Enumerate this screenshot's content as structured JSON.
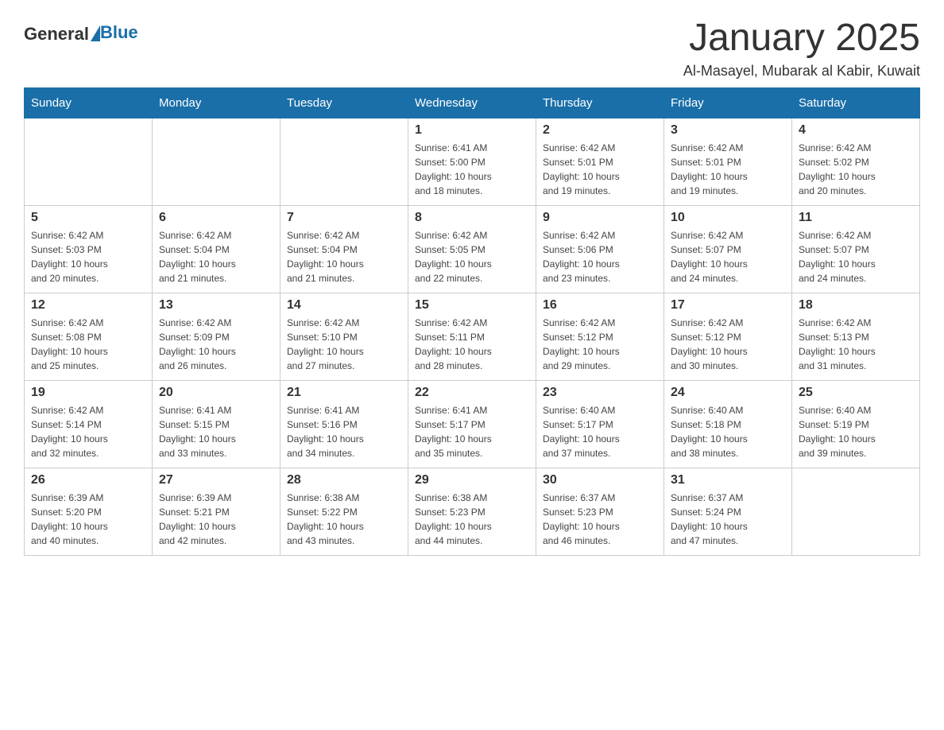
{
  "logo": {
    "general": "General",
    "blue": "Blue"
  },
  "title": "January 2025",
  "subtitle": "Al-Masayel, Mubarak al Kabir, Kuwait",
  "headers": [
    "Sunday",
    "Monday",
    "Tuesday",
    "Wednesday",
    "Thursday",
    "Friday",
    "Saturday"
  ],
  "weeks": [
    [
      {
        "day": "",
        "info": ""
      },
      {
        "day": "",
        "info": ""
      },
      {
        "day": "",
        "info": ""
      },
      {
        "day": "1",
        "info": "Sunrise: 6:41 AM\nSunset: 5:00 PM\nDaylight: 10 hours\nand 18 minutes."
      },
      {
        "day": "2",
        "info": "Sunrise: 6:42 AM\nSunset: 5:01 PM\nDaylight: 10 hours\nand 19 minutes."
      },
      {
        "day": "3",
        "info": "Sunrise: 6:42 AM\nSunset: 5:01 PM\nDaylight: 10 hours\nand 19 minutes."
      },
      {
        "day": "4",
        "info": "Sunrise: 6:42 AM\nSunset: 5:02 PM\nDaylight: 10 hours\nand 20 minutes."
      }
    ],
    [
      {
        "day": "5",
        "info": "Sunrise: 6:42 AM\nSunset: 5:03 PM\nDaylight: 10 hours\nand 20 minutes."
      },
      {
        "day": "6",
        "info": "Sunrise: 6:42 AM\nSunset: 5:04 PM\nDaylight: 10 hours\nand 21 minutes."
      },
      {
        "day": "7",
        "info": "Sunrise: 6:42 AM\nSunset: 5:04 PM\nDaylight: 10 hours\nand 21 minutes."
      },
      {
        "day": "8",
        "info": "Sunrise: 6:42 AM\nSunset: 5:05 PM\nDaylight: 10 hours\nand 22 minutes."
      },
      {
        "day": "9",
        "info": "Sunrise: 6:42 AM\nSunset: 5:06 PM\nDaylight: 10 hours\nand 23 minutes."
      },
      {
        "day": "10",
        "info": "Sunrise: 6:42 AM\nSunset: 5:07 PM\nDaylight: 10 hours\nand 24 minutes."
      },
      {
        "day": "11",
        "info": "Sunrise: 6:42 AM\nSunset: 5:07 PM\nDaylight: 10 hours\nand 24 minutes."
      }
    ],
    [
      {
        "day": "12",
        "info": "Sunrise: 6:42 AM\nSunset: 5:08 PM\nDaylight: 10 hours\nand 25 minutes."
      },
      {
        "day": "13",
        "info": "Sunrise: 6:42 AM\nSunset: 5:09 PM\nDaylight: 10 hours\nand 26 minutes."
      },
      {
        "day": "14",
        "info": "Sunrise: 6:42 AM\nSunset: 5:10 PM\nDaylight: 10 hours\nand 27 minutes."
      },
      {
        "day": "15",
        "info": "Sunrise: 6:42 AM\nSunset: 5:11 PM\nDaylight: 10 hours\nand 28 minutes."
      },
      {
        "day": "16",
        "info": "Sunrise: 6:42 AM\nSunset: 5:12 PM\nDaylight: 10 hours\nand 29 minutes."
      },
      {
        "day": "17",
        "info": "Sunrise: 6:42 AM\nSunset: 5:12 PM\nDaylight: 10 hours\nand 30 minutes."
      },
      {
        "day": "18",
        "info": "Sunrise: 6:42 AM\nSunset: 5:13 PM\nDaylight: 10 hours\nand 31 minutes."
      }
    ],
    [
      {
        "day": "19",
        "info": "Sunrise: 6:42 AM\nSunset: 5:14 PM\nDaylight: 10 hours\nand 32 minutes."
      },
      {
        "day": "20",
        "info": "Sunrise: 6:41 AM\nSunset: 5:15 PM\nDaylight: 10 hours\nand 33 minutes."
      },
      {
        "day": "21",
        "info": "Sunrise: 6:41 AM\nSunset: 5:16 PM\nDaylight: 10 hours\nand 34 minutes."
      },
      {
        "day": "22",
        "info": "Sunrise: 6:41 AM\nSunset: 5:17 PM\nDaylight: 10 hours\nand 35 minutes."
      },
      {
        "day": "23",
        "info": "Sunrise: 6:40 AM\nSunset: 5:17 PM\nDaylight: 10 hours\nand 37 minutes."
      },
      {
        "day": "24",
        "info": "Sunrise: 6:40 AM\nSunset: 5:18 PM\nDaylight: 10 hours\nand 38 minutes."
      },
      {
        "day": "25",
        "info": "Sunrise: 6:40 AM\nSunset: 5:19 PM\nDaylight: 10 hours\nand 39 minutes."
      }
    ],
    [
      {
        "day": "26",
        "info": "Sunrise: 6:39 AM\nSunset: 5:20 PM\nDaylight: 10 hours\nand 40 minutes."
      },
      {
        "day": "27",
        "info": "Sunrise: 6:39 AM\nSunset: 5:21 PM\nDaylight: 10 hours\nand 42 minutes."
      },
      {
        "day": "28",
        "info": "Sunrise: 6:38 AM\nSunset: 5:22 PM\nDaylight: 10 hours\nand 43 minutes."
      },
      {
        "day": "29",
        "info": "Sunrise: 6:38 AM\nSunset: 5:23 PM\nDaylight: 10 hours\nand 44 minutes."
      },
      {
        "day": "30",
        "info": "Sunrise: 6:37 AM\nSunset: 5:23 PM\nDaylight: 10 hours\nand 46 minutes."
      },
      {
        "day": "31",
        "info": "Sunrise: 6:37 AM\nSunset: 5:24 PM\nDaylight: 10 hours\nand 47 minutes."
      },
      {
        "day": "",
        "info": ""
      }
    ]
  ]
}
